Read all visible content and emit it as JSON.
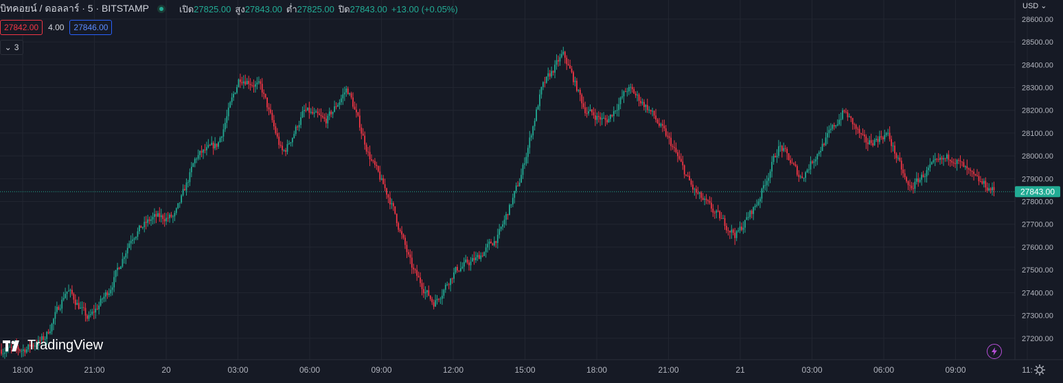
{
  "header": {
    "symbol_title": "บิทคอยน์ / ดอลลาร์ · 5 · BITSTAMP",
    "open_label": "เปิด",
    "open_value": "27825.00",
    "high_label": "สูง",
    "high_value": "27843.00",
    "low_label": "ต่ำ",
    "low_value": "27825.00",
    "close_label": "ปิด",
    "close_value": "27843.00",
    "change": "+13.00 (+0.05%)"
  },
  "quote": {
    "bid": "27842.00",
    "spread": "4.00",
    "ask": "27846.00"
  },
  "indicators": {
    "collapsed_count": "3"
  },
  "price_axis": {
    "currency": "USD",
    "labels": [
      "28600.00",
      "28500.00",
      "28400.00",
      "28300.00",
      "28200.00",
      "28100.00",
      "28000.00",
      "27900.00",
      "27800.00",
      "27700.00",
      "27600.00",
      "27500.00",
      "27400.00",
      "27300.00",
      "27200.00"
    ],
    "current_price_label": "27843.00"
  },
  "time_axis": {
    "labels": [
      "18:00",
      "21:00",
      "20",
      "03:00",
      "06:00",
      "09:00",
      "12:00",
      "15:00",
      "18:00",
      "21:00",
      "21",
      "03:00",
      "06:00",
      "09:00",
      "11:"
    ]
  },
  "branding": {
    "logo_text": "TradingView"
  },
  "colors": {
    "background": "#161a25",
    "up": "#22ab94",
    "down": "#f23645",
    "grid": "#222631",
    "current_price_tag": "#22ab94"
  },
  "icons": {
    "status": "market-status-icon",
    "flash": "lightning-icon",
    "settings": "gear-icon"
  },
  "chart_data": {
    "type": "candlestick",
    "symbol": "BTCUSD",
    "exchange": "BITSTAMP",
    "interval_minutes": 5,
    "ylim": [
      27130,
      28660
    ],
    "current_price": 27843,
    "grid": true,
    "x_labels": [
      "18:00",
      "21:00",
      "20",
      "03:00",
      "06:00",
      "09:00",
      "12:00",
      "15:00",
      "18:00",
      "21:00",
      "21",
      "03:00",
      "06:00",
      "09:00",
      "11:"
    ],
    "trend": [
      [
        "18:00",
        27150
      ],
      [
        "19:30",
        27200
      ],
      [
        "20:00",
        27420
      ],
      [
        "21:00",
        27280
      ],
      [
        "22:30",
        27420
      ],
      [
        "23:30",
        27650
      ],
      [
        "00:30",
        27730
      ],
      [
        "00:30",
        27730
      ],
      [
        "01:00",
        28000
      ],
      [
        "02:00",
        28050
      ],
      [
        "03:00",
        28350
      ],
      [
        "04:00",
        28300
      ],
      [
        "04:30",
        28000
      ],
      [
        "05:00",
        28200
      ],
      [
        "06:00",
        28150
      ],
      [
        "07:00",
        28300
      ],
      [
        "08:00",
        28000
      ],
      [
        "09:00",
        27800
      ],
      [
        "10:00",
        27500
      ],
      [
        "11:00",
        27350
      ],
      [
        "12:00",
        27500
      ],
      [
        "13:00",
        27550
      ],
      [
        "14:00",
        27650
      ],
      [
        "15:00",
        27900
      ],
      [
        "15:30",
        28300
      ],
      [
        "16:00",
        28450
      ],
      [
        "17:00",
        28200
      ],
      [
        "18:00",
        28150
      ],
      [
        "19:00",
        28300
      ],
      [
        "20:00",
        28200
      ],
      [
        "21:00",
        28050
      ],
      [
        "22:00",
        27850
      ],
      [
        "23:00",
        27750
      ],
      [
        "00:00",
        27650
      ],
      [
        "01:00",
        27800
      ],
      [
        "02:00",
        28050
      ],
      [
        "03:00",
        27900
      ],
      [
        "04:00",
        28050
      ],
      [
        "04:30",
        28200
      ],
      [
        "05:00",
        28050
      ],
      [
        "06:00",
        28100
      ],
      [
        "07:00",
        27850
      ],
      [
        "08:00",
        27950
      ],
      [
        "09:00",
        28000
      ],
      [
        "10:00",
        27900
      ],
      [
        "10:30",
        27843
      ]
    ]
  }
}
